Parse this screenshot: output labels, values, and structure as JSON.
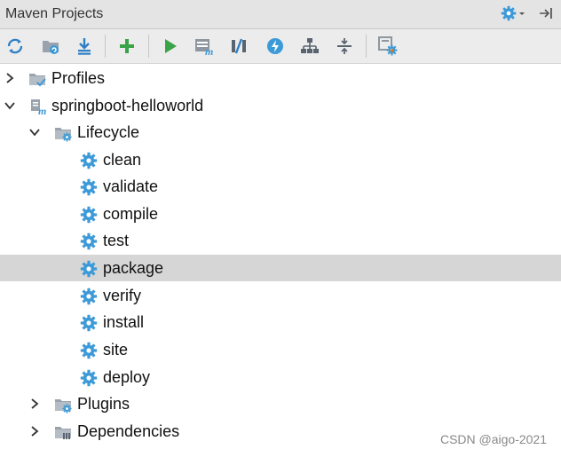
{
  "panel": {
    "title": "Maven Projects"
  },
  "header_icons": [
    "gear-dropdown-icon",
    "hide-panel-icon"
  ],
  "toolbar": [
    "reimport-icon",
    "generate-sources-icon",
    "download-icon",
    "add-project-icon",
    "run-icon",
    "execute-goal-icon",
    "toggle-offline-icon",
    "skip-tests-icon",
    "show-dependencies-icon",
    "collapse-all-icon",
    "settings-icon"
  ],
  "tree": {
    "profiles": "Profiles",
    "project": "springboot-helloworld",
    "lifecycle": "Lifecycle",
    "phases": [
      "clean",
      "validate",
      "compile",
      "test",
      "package",
      "verify",
      "install",
      "site",
      "deploy"
    ],
    "selected_phase": "package",
    "plugins": "Plugins",
    "dependencies": "Dependencies"
  },
  "watermark": "CSDN @aigo-2021",
  "colors": {
    "accent_green": "#3aa347",
    "icon_blue": "#3d9ad8",
    "selection": "#d6d6d6"
  }
}
